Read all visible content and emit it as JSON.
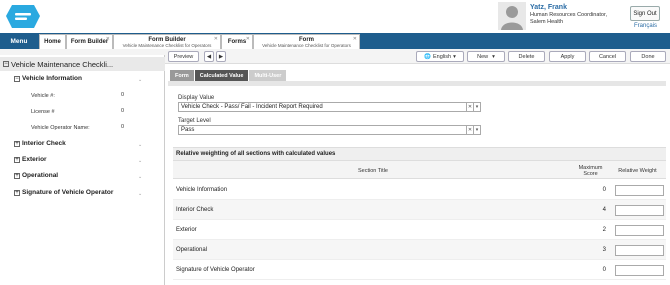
{
  "user": {
    "name": "Yatz, Frank",
    "role_line1": "Human Resources Coordinator,",
    "role_line2": "Salem Health",
    "signout_label": "Sign Out",
    "language_link": "Français"
  },
  "tabs": {
    "menu": "Menu",
    "home": "Home",
    "form_builder_1": "Form Builder",
    "form_builder_2_title": "Form Builder",
    "form_builder_2_sub": "Vehicle Maintenance Checklist for Operators",
    "forms": "Forms",
    "form_title": "Form",
    "form_sub": "Vehicle Maintenance Checklist for Operators"
  },
  "toolbar": {
    "preview": "Preview",
    "prev": "◀",
    "next": "▶",
    "language": "English",
    "new": "New",
    "delete": "Delete",
    "apply": "Apply",
    "cancel": "Cancel",
    "done": "Done"
  },
  "left": {
    "form_title": "Vehicle Maintenance Checkli...",
    "sections": [
      {
        "label": "Vehicle Information",
        "state": "−"
      },
      {
        "label": "Interior Check",
        "state": "+"
      },
      {
        "label": "Exterior",
        "state": "+"
      },
      {
        "label": "Operational",
        "state": "+"
      },
      {
        "label": "Signature of Vehicle Operator",
        "state": "+"
      }
    ],
    "fields": [
      {
        "label": "Vehicle #:",
        "value": "0"
      },
      {
        "label": "License #",
        "value": "0"
      },
      {
        "label": "Vehicle Operator Name:",
        "value": "0"
      }
    ]
  },
  "right": {
    "subtabs": [
      "Form",
      "Calculated Value",
      "Multi-User"
    ],
    "display_value_label": "Display Value",
    "display_value": "Vehicle Check - Pass/ Fail - Incident Report Required",
    "target_level_label": "Target Level",
    "target_level": "Pass",
    "weights_title": "Relative weighting of all sections with calculated values",
    "col_section": "Section Title",
    "col_max": "Maximum Score",
    "col_weight": "Relative Weight",
    "rows": [
      {
        "title": "Vehicle Information",
        "max": "0"
      },
      {
        "title": "Interior Check",
        "max": "4"
      },
      {
        "title": "Exterior",
        "max": "2"
      },
      {
        "title": "Operational",
        "max": "3"
      },
      {
        "title": "Signature of Vehicle Operator",
        "max": "0"
      }
    ]
  }
}
